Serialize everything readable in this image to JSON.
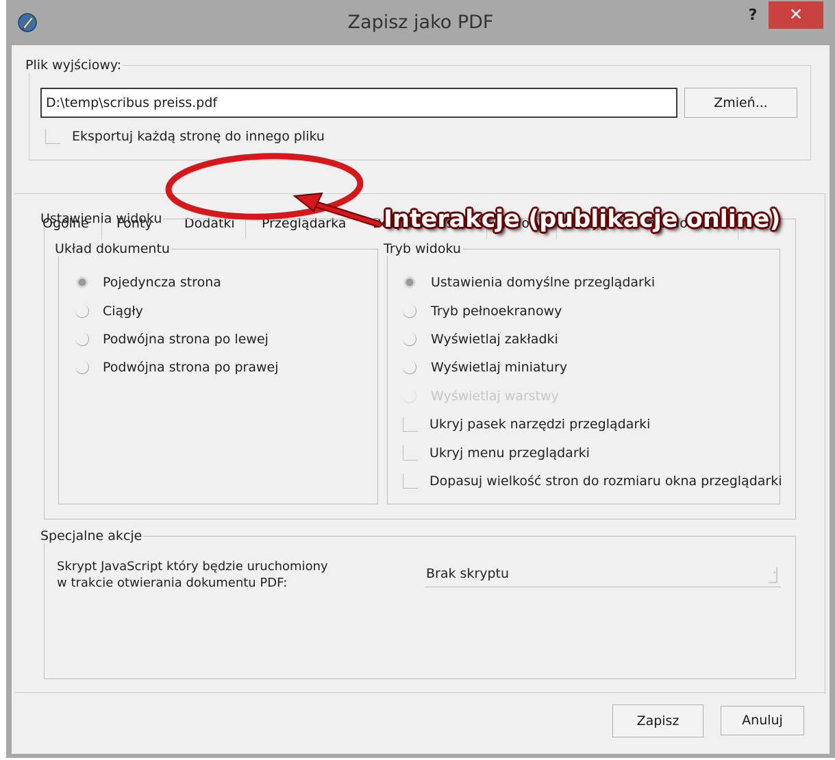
{
  "window": {
    "title": "Zapisz jako PDF",
    "help_label": "?",
    "close_label": "✕"
  },
  "output": {
    "group_label": "Plik wyjściowy:",
    "path_value": "D:\\temp\\scribus preiss.pdf",
    "change_button": "Zmień...",
    "export_each_page_label": "Eksportuj każdą stronę do innego pliku"
  },
  "tabs": [
    {
      "label": "Ogólne"
    },
    {
      "label": "Fonty"
    },
    {
      "label": "Dodatki"
    },
    {
      "label": "Przeglądarka"
    },
    {
      "label": "Bezpieczeństwo"
    },
    {
      "label": "Kolory"
    },
    {
      "label": "Przygotowanie do druku"
    }
  ],
  "active_tab": "Przeglądarka",
  "annotation": {
    "text": "Interakcje (publikacje online)",
    "color": "#d6171c"
  },
  "view_settings": {
    "group_label": "Ustawienia widoku",
    "layout": {
      "group_label": "Układ dokumentu",
      "options": [
        {
          "label": "Pojedyncza strona",
          "selected": true
        },
        {
          "label": "Ciągły",
          "selected": false
        },
        {
          "label": "Podwójna strona po lewej",
          "selected": false
        },
        {
          "label": "Podwójna strona po prawej",
          "selected": false
        }
      ]
    },
    "mode": {
      "group_label": "Tryb widoku",
      "options": [
        {
          "label": "Ustawienia domyślne przeglądarki",
          "selected": true
        },
        {
          "label": "Tryb pełnoekranowy",
          "selected": false
        },
        {
          "label": "Wyświetlaj zakładki",
          "selected": false
        },
        {
          "label": "Wyświetlaj miniatury",
          "selected": false
        },
        {
          "label": "Wyświetlaj warstwy",
          "selected": false,
          "disabled": true
        }
      ],
      "checkboxes": [
        {
          "label": "Ukryj pasek narzędzi przeglądarki",
          "checked": false
        },
        {
          "label": "Ukryj menu przeglądarki",
          "checked": false
        },
        {
          "label": "Dopasuj wielkość stron do rozmiaru okna przeglądarki",
          "checked": false
        }
      ]
    }
  },
  "special_actions": {
    "group_label": "Specjalne akcje",
    "script_label_line1": "Skrypt JavaScript który będzie uruchomiony",
    "script_label_line2": "w trakcie otwierania dokumentu PDF:",
    "script_value": "Brak skryptu"
  },
  "footer": {
    "save_button": "Zapisz",
    "cancel_button": "Anuluj"
  }
}
